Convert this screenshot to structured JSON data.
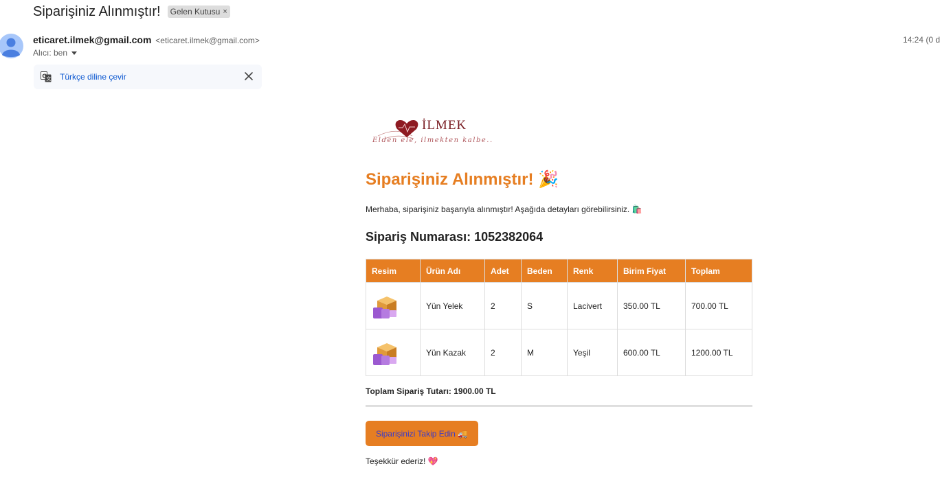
{
  "email_header": {
    "subject": "Siparişiniz Alınmıştır!",
    "label": "Gelen Kutusu",
    "label_remove": "×",
    "sender_name": "eticaret.ilmek@gmail.com",
    "sender_email": "<eticaret.ilmek@gmail.com>",
    "recipient": "Alıcı: ben",
    "timestamp": "14:24 (0 d"
  },
  "translate_bar": {
    "link": "Türkçe diline çevir"
  },
  "message": {
    "logo_text": "İLMEK",
    "logo_tagline": "Elden ele, ilmekten kalbe..",
    "heading": "Siparişiniz Alınmıştır! 🎉",
    "intro": "Merhaba, siparişiniz başarıyla alınmıştır! Aşağıda detayları görebilirsiniz. 🛍️",
    "order_label": "Sipariş Numarası:",
    "order_number": "1052382064",
    "table": {
      "headers": [
        "Resim",
        "Ürün Adı",
        "Adet",
        "Beden",
        "Renk",
        "Birim Fiyat",
        "Toplam"
      ],
      "rows": [
        {
          "name": "Yün Yelek",
          "qty": "2",
          "size": "S",
          "color": "Lacivert",
          "unit_price": "350.00 TL",
          "total": "700.00 TL"
        },
        {
          "name": "Yün Kazak",
          "qty": "2",
          "size": "M",
          "color": "Yeşil",
          "unit_price": "600.00 TL",
          "total": "1200.00 TL"
        }
      ]
    },
    "total_text": "Toplam Sipariş Tutarı: 1900.00 TL",
    "cta": "Siparişinizi Takip Edin 🚚",
    "thanks": "Teşekkür ederiz! 💖"
  },
  "colors": {
    "accent": "#e67e22",
    "link": "#0b57d0",
    "brand": "#7a1e24"
  },
  "icons": [
    "avatar-icon",
    "translate-icon",
    "close-icon",
    "chevron-down-icon",
    "heart-logo-icon",
    "package-icon"
  ]
}
